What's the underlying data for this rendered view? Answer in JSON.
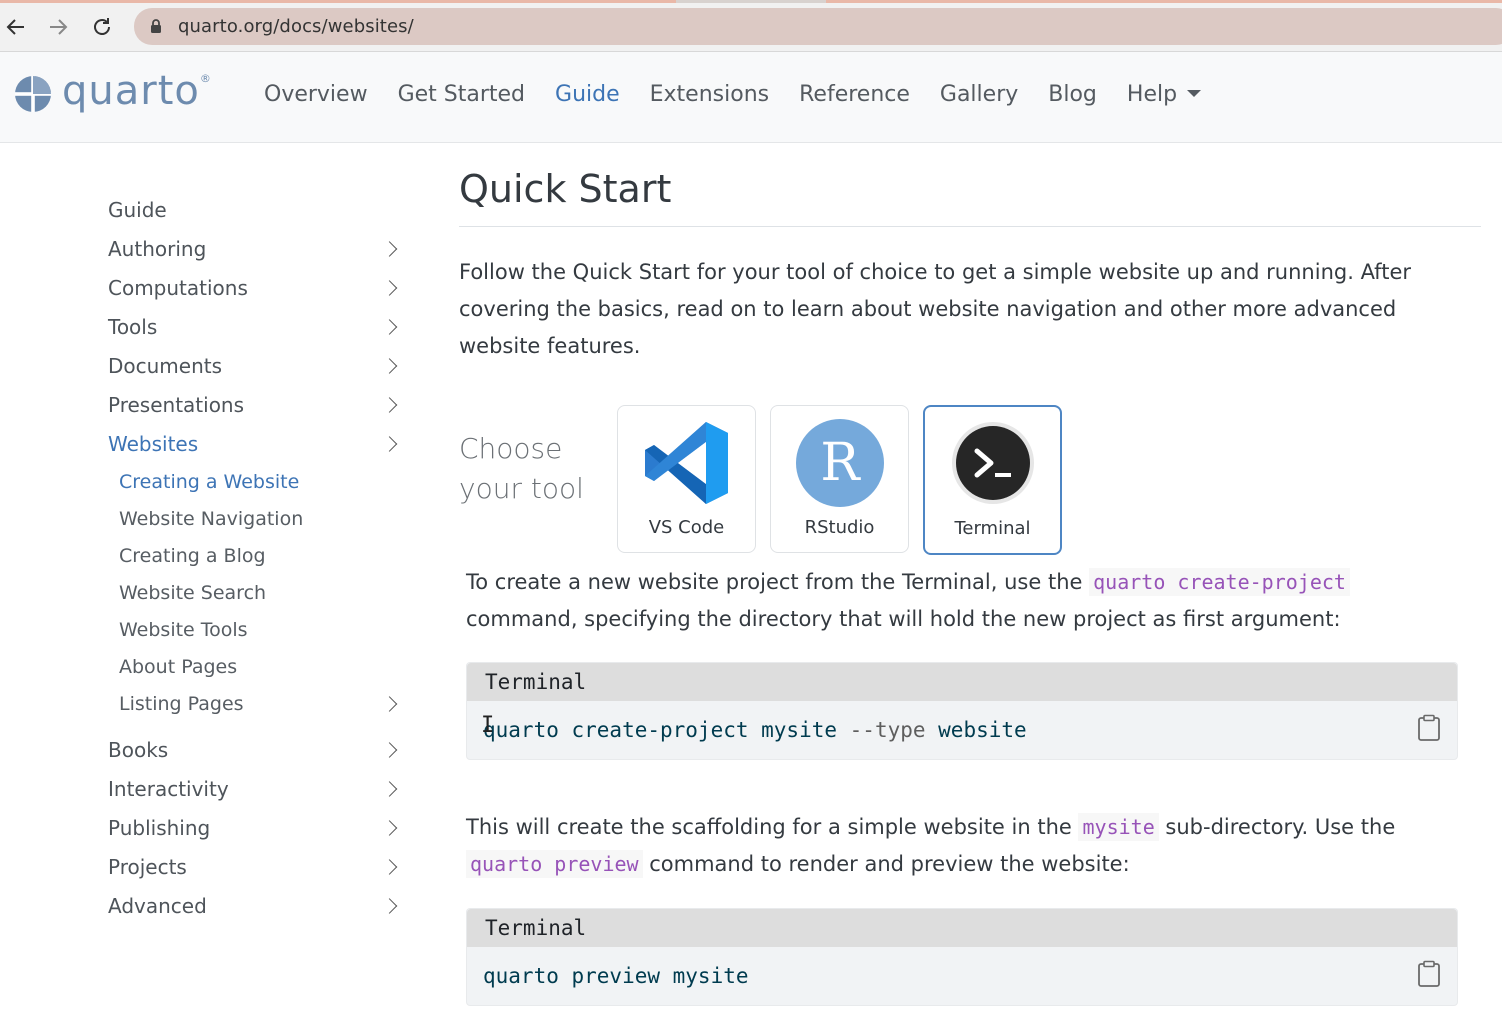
{
  "browser": {
    "url": "quarto.org/docs/websites/"
  },
  "navbar": {
    "logo_text": "quarto",
    "logo_mark": "®",
    "items": [
      {
        "label": "Overview"
      },
      {
        "label": "Get Started"
      },
      {
        "label": "Guide"
      },
      {
        "label": "Extensions"
      },
      {
        "label": "Reference"
      },
      {
        "label": "Gallery"
      },
      {
        "label": "Blog"
      },
      {
        "label": "Help"
      }
    ]
  },
  "sidebar": {
    "items": [
      {
        "label": "Guide"
      },
      {
        "label": "Authoring"
      },
      {
        "label": "Computations"
      },
      {
        "label": "Tools"
      },
      {
        "label": "Documents"
      },
      {
        "label": "Presentations"
      },
      {
        "label": "Websites"
      },
      {
        "label": "Books"
      },
      {
        "label": "Interactivity"
      },
      {
        "label": "Publishing"
      },
      {
        "label": "Projects"
      },
      {
        "label": "Advanced"
      }
    ],
    "website_children": [
      {
        "label": "Creating a Website"
      },
      {
        "label": "Website Navigation"
      },
      {
        "label": "Creating a Blog"
      },
      {
        "label": "Website Search"
      },
      {
        "label": "Website Tools"
      },
      {
        "label": "About Pages"
      },
      {
        "label": "Listing Pages"
      }
    ]
  },
  "main": {
    "title": "Quick Start",
    "intro": "Follow the Quick Start for your tool of choice to get a simple website up and running. After covering the basics, read on to learn about website navigation and other more advanced website features.",
    "choose_line1": "Choose",
    "choose_line2": "your tool",
    "tools": [
      {
        "label": "VS Code"
      },
      {
        "label": "RStudio"
      },
      {
        "label": "Terminal"
      }
    ],
    "para1_before": "To create a new website project from the Terminal, use the ",
    "para1_code": "quarto create-project",
    "para1_after": " command, specifying the directory that will hold the new project as first argument:",
    "code1": {
      "header": "Terminal",
      "cmd": "quarto create-project mysite ",
      "flag": "--type",
      "arg": " website"
    },
    "para2_before": "This will create the scaffolding for a simple website in the ",
    "para2_code1": "mysite",
    "para2_mid": " sub-directory. Use the ",
    "para2_code2": "quarto preview",
    "para2_after": " command to render and preview the website:",
    "code2": {
      "header": "Terminal",
      "cmd": "quarto preview mysite"
    }
  },
  "colors": {
    "accent": "#3d74b5",
    "inline_code": "#9753b8",
    "code_text": "#003b4f"
  }
}
